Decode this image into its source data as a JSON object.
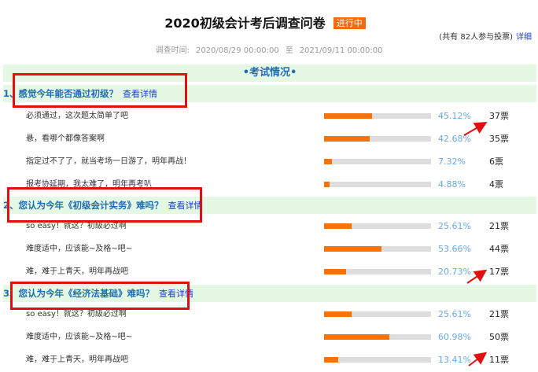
{
  "header": {
    "title": "2020初级会计考后调查问卷",
    "status_badge": "进行中",
    "summary": "(共有 82人参与投票)",
    "details_link": "详细",
    "period_label": "调查时间:",
    "start": "2020/08/29 00:00:00",
    "to": "至",
    "end": "2021/09/11 00:00:00"
  },
  "section_title": "•考试情况•",
  "colors": {
    "accent": "#f5720d",
    "question": "#1f6db5",
    "percent": "#69a8e8",
    "highlight": "#e01010",
    "band": "#e4f8e4"
  },
  "questions": [
    {
      "title": "1、感觉今年能否通过初级？",
      "link": "查看详情",
      "options": [
        {
          "label": "必须通过，这次题太简单了吧",
          "percent": 45.12,
          "percent_text": "45.12%",
          "votes": "37票"
        },
        {
          "label": "悬，看哪个都像答案啊",
          "percent": 42.68,
          "percent_text": "42.68%",
          "votes": "35票"
        },
        {
          "label": "指定过不了了，就当考场一日游了，明年再战！",
          "percent": 7.32,
          "percent_text": "7.32%",
          "votes": "6票"
        },
        {
          "label": "报考协延期，我太难了，明年再考叭",
          "percent": 4.88,
          "percent_text": "4.88%",
          "votes": "4票"
        }
      ]
    },
    {
      "title": "2、您认为今年《初级会计实务》难吗？",
      "link": "查看详情",
      "options": [
        {
          "label": "so easy！就这？初级必过啊",
          "percent": 25.61,
          "percent_text": "25.61%",
          "votes": "21票"
        },
        {
          "label": "难度适中，应该能~及格~吧~",
          "percent": 53.66,
          "percent_text": "53.66%",
          "votes": "44票"
        },
        {
          "label": "难，难于上青天，明年再战吧",
          "percent": 20.73,
          "percent_text": "20.73%",
          "votes": "17票"
        }
      ]
    },
    {
      "title": "3、您认为今年《经济法基础》难吗？",
      "link": "查看详情",
      "options": [
        {
          "label": "so easy！就这？初级必过啊",
          "percent": 25.61,
          "percent_text": "25.61%",
          "votes": "21票"
        },
        {
          "label": "难度适中，应该能~及格~吧~",
          "percent": 60.98,
          "percent_text": "60.98%",
          "votes": "50票"
        },
        {
          "label": "难，难于上青天，明年再战吧",
          "percent": 13.41,
          "percent_text": "13.41%",
          "votes": "11票"
        }
      ]
    }
  ]
}
